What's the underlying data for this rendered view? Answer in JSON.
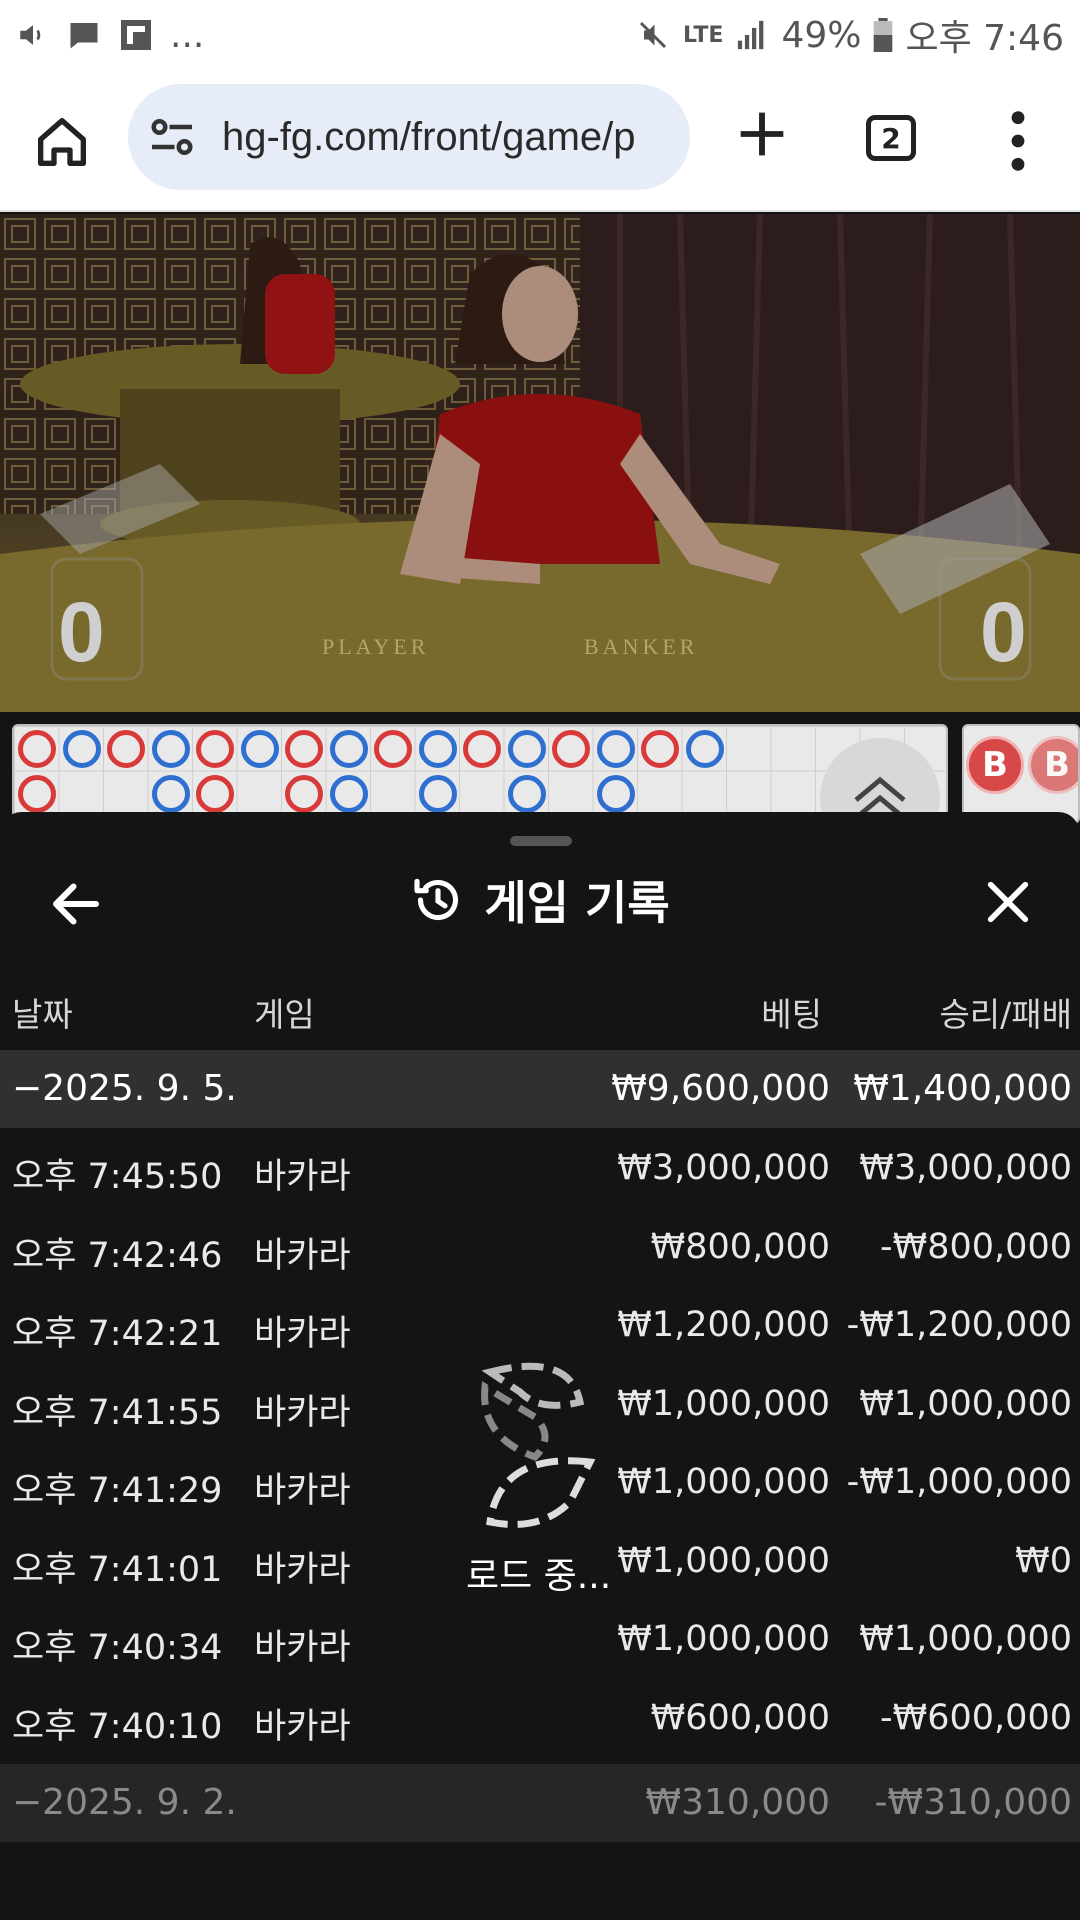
{
  "status_bar": {
    "left_more": "...",
    "network": "LTE",
    "battery": "49%",
    "time": "오후 7:46"
  },
  "browser": {
    "url": "hg-fg.com/front/game/p",
    "tab_count": "2"
  },
  "video": {
    "player_score": "0",
    "banker_score": "0",
    "player_label": "PLAYER",
    "banker_label": "BANKER"
  },
  "road": {
    "top_row": [
      "red",
      "blue",
      "red",
      "blue",
      "red",
      "blue",
      "red",
      "blue",
      "red",
      "blue",
      "red",
      "blue",
      "red",
      "blue",
      "red",
      "blue"
    ],
    "bottom_row": [
      [
        "red",
        0
      ],
      [
        "blue",
        3
      ],
      [
        "red",
        4
      ],
      [
        "red",
        6
      ],
      [
        "blue",
        7
      ],
      [
        "blue",
        9
      ],
      [
        "blue",
        11
      ],
      [
        "blue",
        13
      ]
    ],
    "side_chip": "B"
  },
  "panel": {
    "title": "게임 기록",
    "headers": {
      "date": "날짜",
      "game": "게임",
      "bet": "베팅",
      "win_loss": "승리/패배"
    },
    "groups": [
      {
        "date": "−2025. 9. 5.",
        "bet": "₩9,600,000",
        "win_loss": "₩1,400,000",
        "rows": [
          {
            "time": "오후 7:45:50",
            "game": "바카라",
            "bet": "₩3,000,000",
            "win_loss": "₩3,000,000"
          },
          {
            "time": "오후 7:42:46",
            "game": "바카라",
            "bet": "₩800,000",
            "win_loss": "-₩800,000"
          },
          {
            "time": "오후 7:42:21",
            "game": "바카라",
            "bet": "₩1,200,000",
            "win_loss": "-₩1,200,000"
          },
          {
            "time": "오후 7:41:55",
            "game": "바카라",
            "bet": "₩1,000,000",
            "win_loss": "₩1,000,000"
          },
          {
            "time": "오후 7:41:29",
            "game": "바카라",
            "bet": "₩1,000,000",
            "win_loss": "-₩1,000,000"
          },
          {
            "time": "오후 7:41:01",
            "game": "바카라",
            "bet": "₩1,000,000",
            "win_loss": "₩0"
          },
          {
            "time": "오후 7:40:34",
            "game": "바카라",
            "bet": "₩1,000,000",
            "win_loss": "₩1,000,000"
          },
          {
            "time": "오후 7:40:10",
            "game": "바카라",
            "bet": "₩600,000",
            "win_loss": "-₩600,000"
          }
        ]
      },
      {
        "date": "−2025. 9. 2.",
        "bet": "₩310,000",
        "win_loss": "-₩310,000",
        "rows": []
      }
    ],
    "loading_text": "로드 중..."
  },
  "colors": {
    "road_red": "#d83a3a",
    "road_blue": "#2f6fd0",
    "panel_bg": "#141414",
    "group_bg": "#303030"
  }
}
